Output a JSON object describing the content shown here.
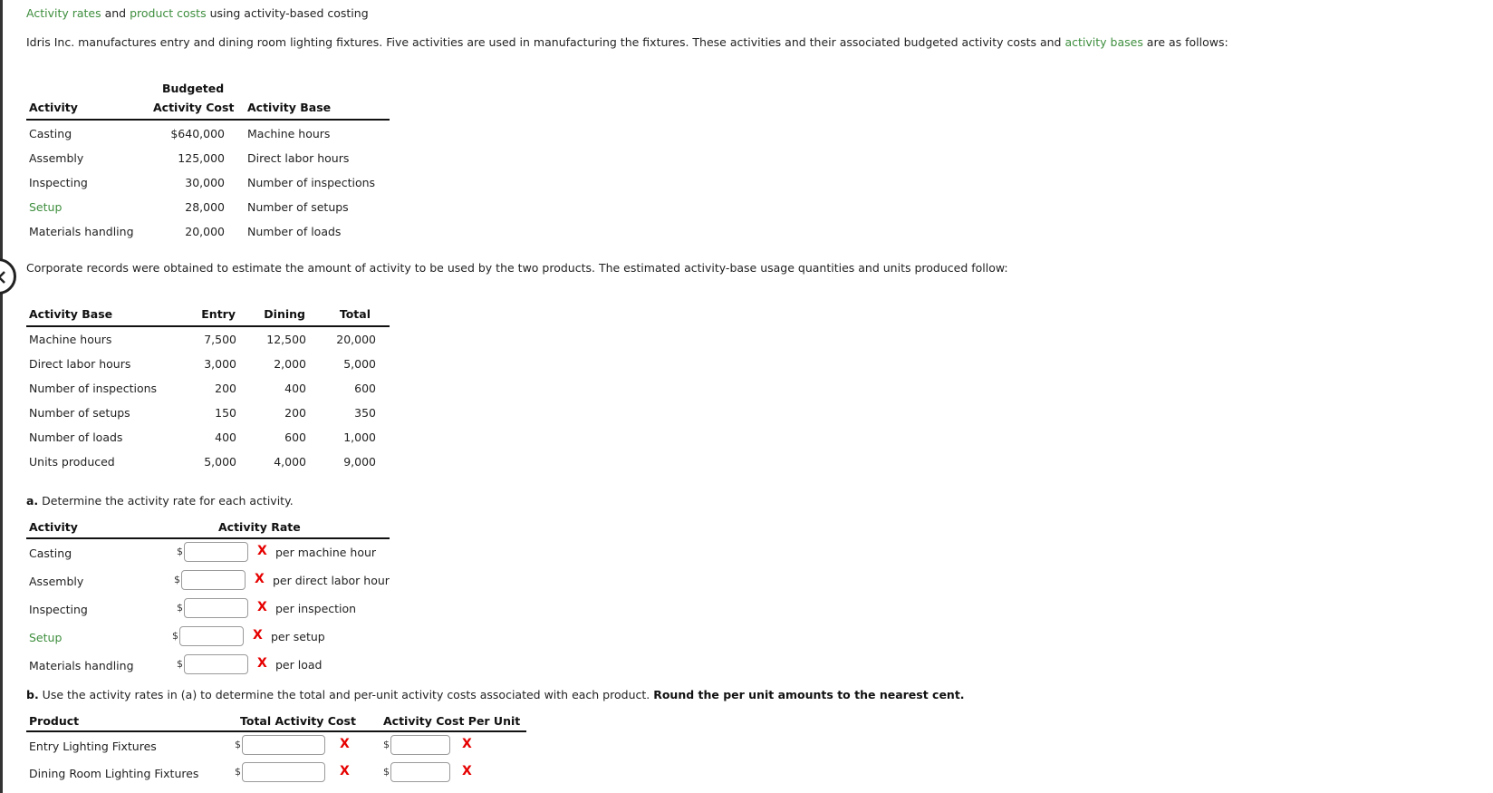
{
  "header": {
    "title_parts": [
      {
        "text": "Activity rates",
        "link": true
      },
      {
        "text": " and ",
        "link": false
      },
      {
        "text": "product costs",
        "link": true
      },
      {
        "text": " using activity-based costing",
        "link": false
      }
    ]
  },
  "intro": {
    "before": "Idris Inc. manufactures entry and dining room lighting fixtures. Five activities are used in manufacturing the fixtures. These activities and their associated budgeted activity costs and ",
    "link": "activity bases",
    "after": " are as follows:"
  },
  "table1": {
    "headers": {
      "activity": "Activity",
      "cost_top": "Budgeted",
      "cost": "Activity Cost",
      "base": "Activity Base"
    },
    "rows": [
      {
        "activity": "Casting",
        "cost": "$640,000",
        "base": "Machine hours",
        "link": false
      },
      {
        "activity": "Assembly",
        "cost": "125,000",
        "base": "Direct labor hours",
        "link": false
      },
      {
        "activity": "Inspecting",
        "cost": "30,000",
        "base": "Number of inspections",
        "link": false
      },
      {
        "activity": "Setup",
        "cost": "28,000",
        "base": "Number of setups",
        "link": true
      },
      {
        "activity": "Materials handling",
        "cost": "20,000",
        "base": "Number of loads",
        "link": false
      }
    ]
  },
  "corporate_text": "Corporate records were obtained to estimate the amount of activity to be used by the two products. The estimated activity-base usage quantities and units produced follow:",
  "table2": {
    "headers": {
      "base": "Activity Base",
      "entry": "Entry",
      "dining": "Dining",
      "total": "Total"
    },
    "rows": [
      {
        "base": "Machine hours",
        "entry": "7,500",
        "dining": "12,500",
        "total": "20,000"
      },
      {
        "base": "Direct labor hours",
        "entry": "3,000",
        "dining": "2,000",
        "total": "5,000"
      },
      {
        "base": "Number of inspections",
        "entry": "200",
        "dining": "400",
        "total": "600"
      },
      {
        "base": "Number of setups",
        "entry": "150",
        "dining": "200",
        "total": "350"
      },
      {
        "base": "Number of loads",
        "entry": "400",
        "dining": "600",
        "total": "1,000"
      },
      {
        "base": "Units produced",
        "entry": "5,000",
        "dining": "4,000",
        "total": "9,000"
      }
    ]
  },
  "part_a": {
    "label": "a.",
    "text": " Determine the activity rate for each activity.",
    "headers": {
      "activity": "Activity",
      "rate": "Activity Rate"
    },
    "rows": [
      {
        "activity": "Casting",
        "currency": "$",
        "value": "",
        "status": "X",
        "unit": "per machine hour",
        "link": false
      },
      {
        "activity": "Assembly",
        "currency": "$",
        "value": "",
        "status": "X",
        "unit": "per direct labor hour",
        "link": false
      },
      {
        "activity": "Inspecting",
        "currency": "$",
        "value": "",
        "status": "X",
        "unit": "per inspection",
        "link": false
      },
      {
        "activity": "Setup",
        "currency": "$",
        "value": "",
        "status": "X",
        "unit": "per setup",
        "link": true
      },
      {
        "activity": "Materials handling",
        "currency": "$",
        "value": "",
        "status": "X",
        "unit": "per load",
        "link": false
      }
    ]
  },
  "part_b": {
    "label": "b.",
    "text": " Use the activity rates in (a) to determine the total and per-unit activity costs associated with each product. ",
    "bold_text": "Round the per unit amounts to the nearest cent.",
    "headers": {
      "product": "Product",
      "total": "Total Activity Cost",
      "per_unit": "Activity Cost Per Unit"
    },
    "rows": [
      {
        "product": "Entry Lighting Fixtures",
        "currency": "$",
        "total": "",
        "total_status": "X",
        "per_unit": "",
        "per_unit_status": "X"
      },
      {
        "product": "Dining Room Lighting Fixtures",
        "currency": "$",
        "total": "",
        "total_status": "X",
        "per_unit": "",
        "per_unit_status": "X"
      }
    ]
  },
  "icons": {
    "back": "chevron-left-icon",
    "incorrect": "red-x-mark"
  },
  "colors": {
    "link": "#3e8e3e",
    "incorrect": "#e60000",
    "text": "#222222"
  }
}
